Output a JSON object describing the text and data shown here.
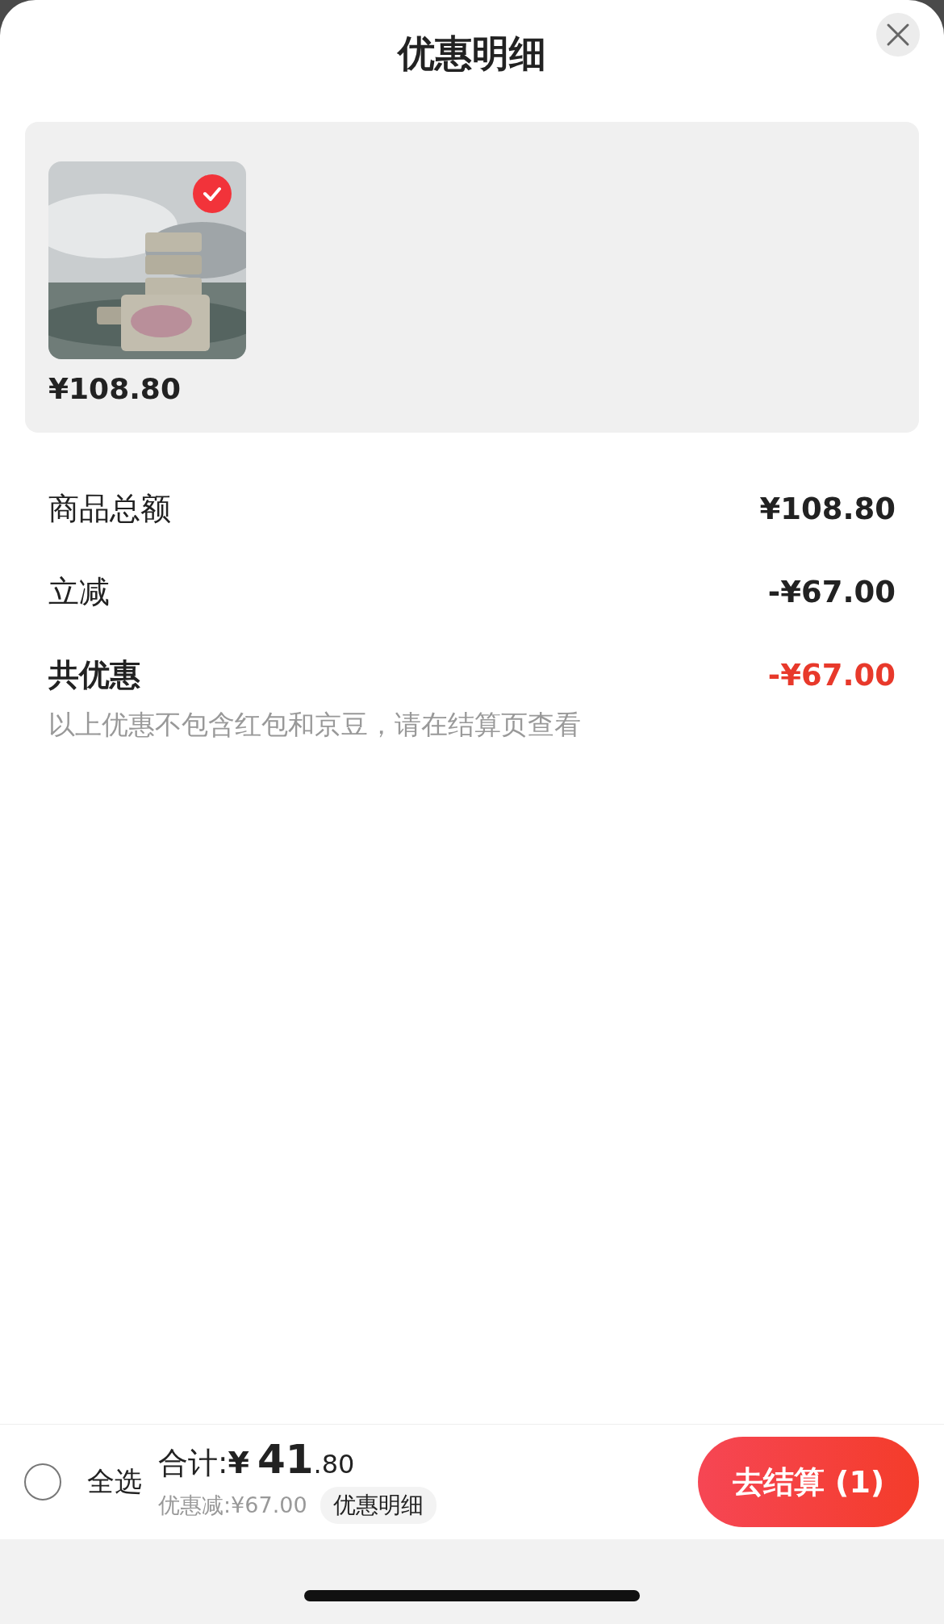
{
  "sheet": {
    "title": "优惠明细"
  },
  "products": [
    {
      "kind": "picture",
      "selected": true,
      "price": "¥108.80"
    }
  ],
  "summary": [
    {
      "label": "商品总额",
      "value": "¥108.80",
      "emphasis": false
    },
    {
      "label": "立减",
      "value": "-¥67.00",
      "emphasis": false
    },
    {
      "label": "共优惠",
      "value": "-¥67.00",
      "emphasis": true
    }
  ],
  "note": "以上优惠不包含红包和京豆，请在结算页查看",
  "footer": {
    "select_all": {
      "label": "全选",
      "checked": false
    },
    "total_label": "合计:",
    "currency": "¥",
    "total_integer": "41",
    "total_decimal": ".80",
    "discount_text": "优惠减:¥67.00",
    "detail_chip": "优惠明细",
    "checkout_button": "去结算 (1)"
  }
}
